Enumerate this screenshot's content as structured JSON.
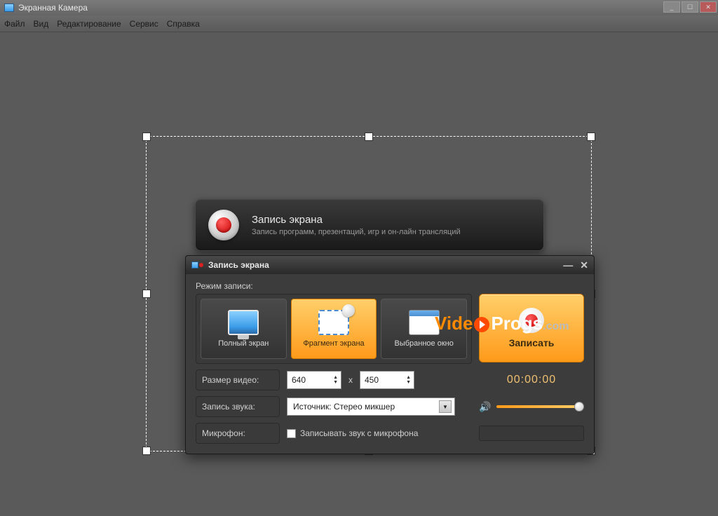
{
  "titlebar": {
    "title": "Экранная Камера"
  },
  "menubar": {
    "file": "Файл",
    "view": "Вид",
    "edit": "Редактирование",
    "service": "Сервис",
    "help": "Справка"
  },
  "banner": {
    "title": "Запись экрана",
    "subtitle": "Запись программ, презентаций, игр и он-лайн трансляций"
  },
  "dialog": {
    "title": "Запись экрана",
    "mode_label": "Режим записи:",
    "modes": {
      "full": "Полный экран",
      "fragment": "Фрагмент экрана",
      "window": "Выбранное окно"
    },
    "record_label": "Записать",
    "size_label": "Размер видео:",
    "width": "640",
    "height": "450",
    "x": "x",
    "timer": "00:00:00",
    "audio_label": "Запись звука:",
    "audio_source": "Источник: Стерео микшер",
    "mic_label": "Микрофон:",
    "mic_checkbox": "Записывать звук с микрофона"
  },
  "watermark": {
    "a": "Vide",
    "b": "Progs",
    "c": ".com"
  }
}
